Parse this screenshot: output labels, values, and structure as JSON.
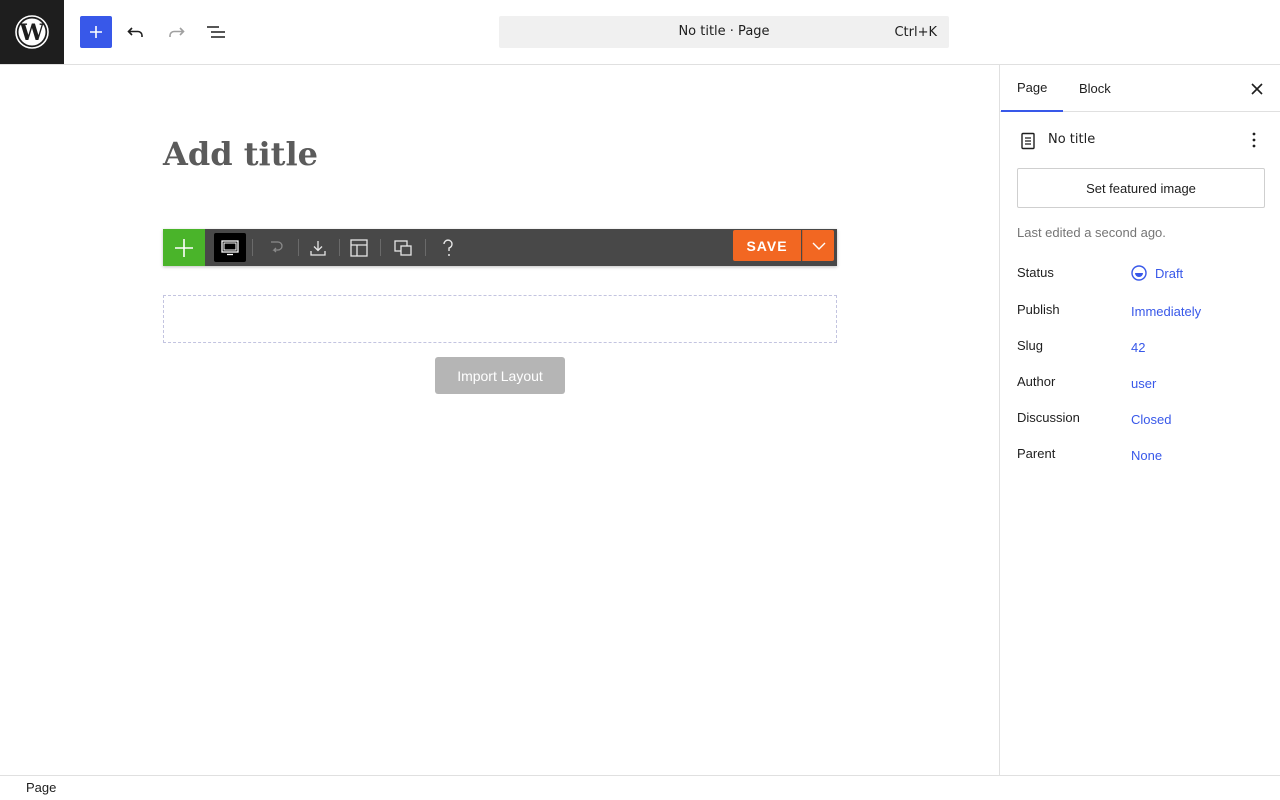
{
  "colors": {
    "accent": "#3858e9",
    "builder_add": "#4ab42a",
    "builder_save": "#f26722",
    "builder_toolbar": "#484848",
    "import_button": "#b5b5b5"
  },
  "header": {
    "logo_icon": "wordpress-logo-icon",
    "add_icon": "plus-icon",
    "undo_icon": "undo-icon",
    "redo_icon": "redo-icon",
    "list_view_icon": "list-view-icon",
    "command_bar": {
      "title": "No title · Page",
      "shortcut": "Ctrl+K"
    }
  },
  "editor": {
    "title_placeholder": "Add title",
    "builder_toolbar": {
      "icons": [
        "plus-icon",
        "screen-icon",
        "history-icon",
        "download-icon",
        "layout-icon",
        "responsive-icon",
        "help-icon"
      ],
      "save_label": "SAVE",
      "save_menu_icon": "chevron-down-icon"
    },
    "import_layout_label": "Import Layout"
  },
  "sidebar": {
    "tabs": [
      {
        "label": "Page",
        "active": true
      },
      {
        "label": "Block",
        "active": false
      }
    ],
    "close_icon": "close-icon",
    "document": {
      "icon": "page-icon",
      "title": "No title",
      "more_icon": "more-vertical-icon"
    },
    "featured_image_label": "Set featured image",
    "last_edited": "Last edited a second ago.",
    "meta": [
      {
        "label": "Status",
        "value": "Draft",
        "icon": "draft-icon"
      },
      {
        "label": "Publish",
        "value": "Immediately"
      },
      {
        "label": "Slug",
        "value": "42"
      },
      {
        "label": "Author",
        "value": "user"
      },
      {
        "label": "Discussion",
        "value": "Closed"
      },
      {
        "label": "Parent",
        "value": "None"
      }
    ]
  },
  "footer": {
    "breadcrumb": "Page"
  }
}
